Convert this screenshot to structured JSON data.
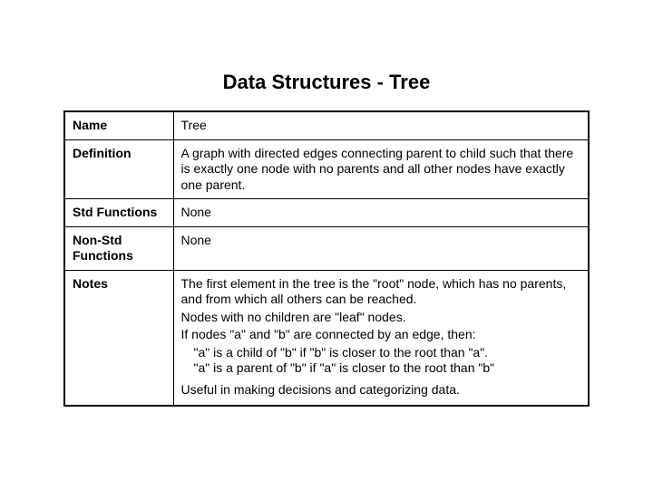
{
  "title": "Data Structures - Tree",
  "rows": {
    "name_label": "Name",
    "name_value": "Tree",
    "definition_label": "Definition",
    "definition_value": "A graph with directed edges connecting parent to child such that there is exactly one node with no parents and all other nodes have exactly one parent.",
    "stdfn_label": "Std Functions",
    "stdfn_value": "None",
    "nonstdfn_label": "Non-Std Functions",
    "nonstdfn_value": "None",
    "notes_label": "Notes",
    "notes": {
      "p1": "The first element in the tree is the \"root\" node, which has no parents, and from which all others can be reached.",
      "p2": "Nodes with no children are \"leaf\" nodes.",
      "p3": "If nodes \"a\" and \"b\" are connected by an edge, then:",
      "p3a": "\"a\" is a child of \"b\" if \"b\" is closer to the root than \"a\".",
      "p3b": "\"a\" is a parent of \"b\" if \"a\" is closer to the root than \"b\"",
      "p4": "Useful in making decisions and categorizing data."
    }
  }
}
